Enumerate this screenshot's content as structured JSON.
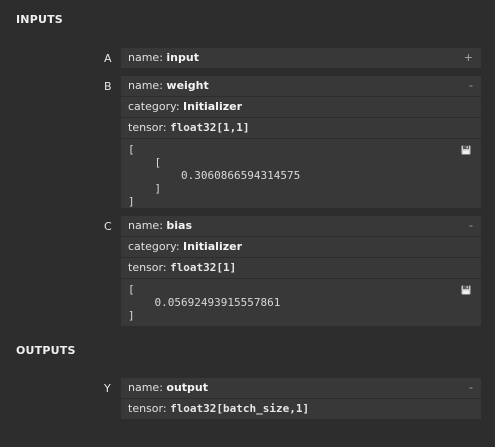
{
  "inputs_header": "INPUTS",
  "outputs_header": "OUTPUTS",
  "inputs": [
    {
      "letter": "A",
      "name_key": "name:",
      "name": "input",
      "toggle": "+"
    },
    {
      "letter": "B",
      "name_key": "name:",
      "name": "weight",
      "toggle": "-",
      "category_key": "category:",
      "category": "Initializer",
      "tensor_key": "tensor:",
      "tensor_type": "float32[1,1]",
      "tensor_value": "[\n    [\n        0.3060866594314575\n    ]\n]",
      "save_icon": "save-icon"
    },
    {
      "letter": "C",
      "name_key": "name:",
      "name": "bias",
      "toggle": "-",
      "category_key": "category:",
      "category": "Initializer",
      "tensor_key": "tensor:",
      "tensor_type": "float32[1]",
      "tensor_value": "[\n    0.05692493915557861\n]",
      "save_icon": "save-icon"
    }
  ],
  "outputs": [
    {
      "letter": "Y",
      "name_key": "name:",
      "name": "output",
      "toggle": "-",
      "tensor_key": "tensor:",
      "tensor_type": "float32[batch_size,1]"
    }
  ],
  "colors": {
    "background": "#2d2d2d",
    "card": "#383838",
    "text": "#e6e6e6"
  }
}
